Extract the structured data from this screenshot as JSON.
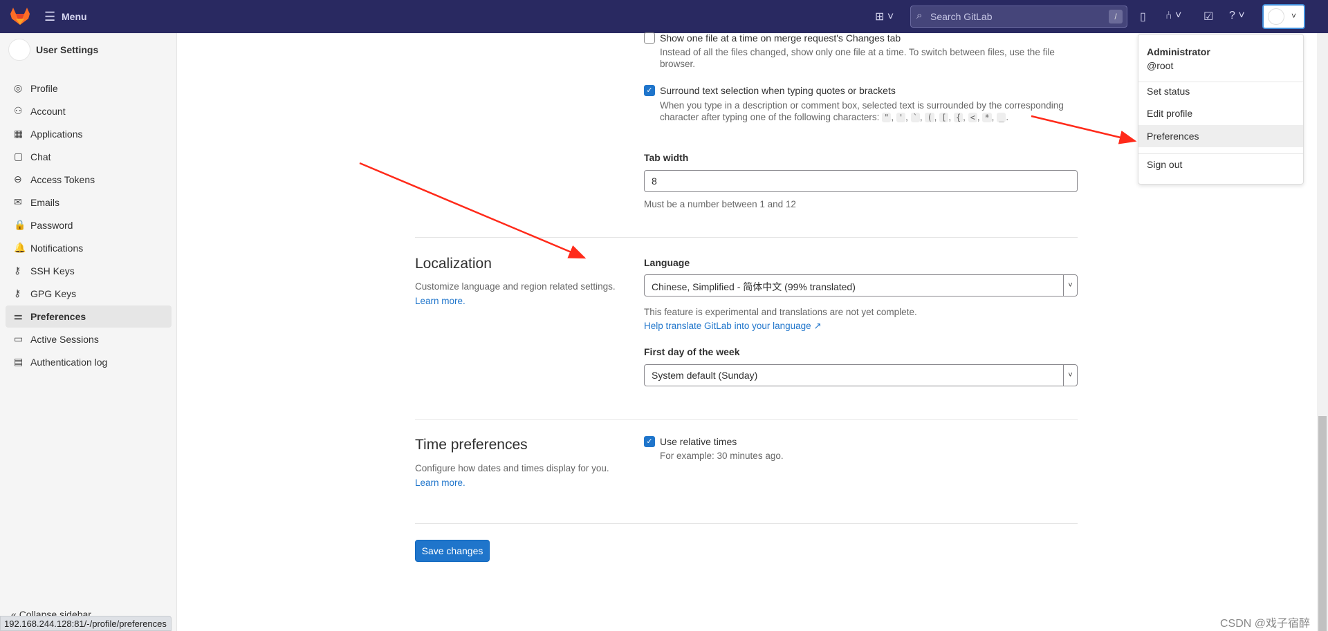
{
  "header": {
    "menu_label": "Menu",
    "search_placeholder": "Search GitLab",
    "search_shortcut": "/"
  },
  "sidebar": {
    "title": "User Settings",
    "items": [
      {
        "label": "Profile",
        "icon": "profile-icon",
        "glyph": "◎"
      },
      {
        "label": "Account",
        "icon": "account-icon",
        "glyph": "⚇"
      },
      {
        "label": "Applications",
        "icon": "applications-icon",
        "glyph": "▦"
      },
      {
        "label": "Chat",
        "icon": "chat-icon",
        "glyph": "▢"
      },
      {
        "label": "Access Tokens",
        "icon": "token-icon",
        "glyph": "⊖"
      },
      {
        "label": "Emails",
        "icon": "email-icon",
        "glyph": "✉"
      },
      {
        "label": "Password",
        "icon": "lock-icon",
        "glyph": "🔒"
      },
      {
        "label": "Notifications",
        "icon": "bell-icon",
        "glyph": "🔔"
      },
      {
        "label": "SSH Keys",
        "icon": "key-icon",
        "glyph": "⚷"
      },
      {
        "label": "GPG Keys",
        "icon": "key-icon",
        "glyph": "⚷"
      },
      {
        "label": "Preferences",
        "icon": "preferences-icon",
        "glyph": "⚌",
        "active": true
      },
      {
        "label": "Active Sessions",
        "icon": "monitor-icon",
        "glyph": "▭"
      },
      {
        "label": "Authentication log",
        "icon": "log-icon",
        "glyph": "▤"
      }
    ],
    "collapse_label": "Collapse sidebar"
  },
  "behavior": {
    "show_one_file": {
      "label": "Show one file at a time on merge request's Changes tab",
      "help": "Instead of all the files changed, show only one file at a time. To switch between files, use the file browser.",
      "checked": false
    },
    "surround": {
      "label": "Surround text selection when typing quotes or brackets",
      "help": "When you type in a description or comment box, selected text is surrounded by the corresponding character after typing one of the following characters:",
      "chars": [
        "\"",
        "'",
        "`",
        "(",
        "[",
        "{",
        "<",
        "*",
        "_"
      ],
      "checked": true
    },
    "tab_width": {
      "label": "Tab width",
      "value": "8",
      "help": "Must be a number between 1 and 12"
    }
  },
  "localization": {
    "title": "Localization",
    "desc": "Customize language and region related settings.",
    "learn_more": "Learn more.",
    "language_label": "Language",
    "language_value": "Chinese, Simplified - 简体中文 (99% translated)",
    "language_help": "This feature is experimental and translations are not yet complete.",
    "translate_link": "Help translate GitLab into your language",
    "week_label": "First day of the week",
    "week_value": "System default (Sunday)"
  },
  "time": {
    "title": "Time preferences",
    "desc": "Configure how dates and times display for you.",
    "learn_more": "Learn more.",
    "relative_label": "Use relative times",
    "relative_help": "For example: 30 minutes ago.",
    "checked": true
  },
  "save_label": "Save changes",
  "user_menu": {
    "name": "Administrator",
    "username": "@root",
    "items": [
      "Set status",
      "Edit profile",
      "Preferences",
      "Sign out"
    ]
  },
  "status_url": "192.168.244.128:81/-/profile/preferences",
  "watermark": "CSDN @戏子宿醉",
  "colors": {
    "header": "#292961",
    "primary": "#1f75cb",
    "annotation_arrow": "#ff2a1a"
  }
}
